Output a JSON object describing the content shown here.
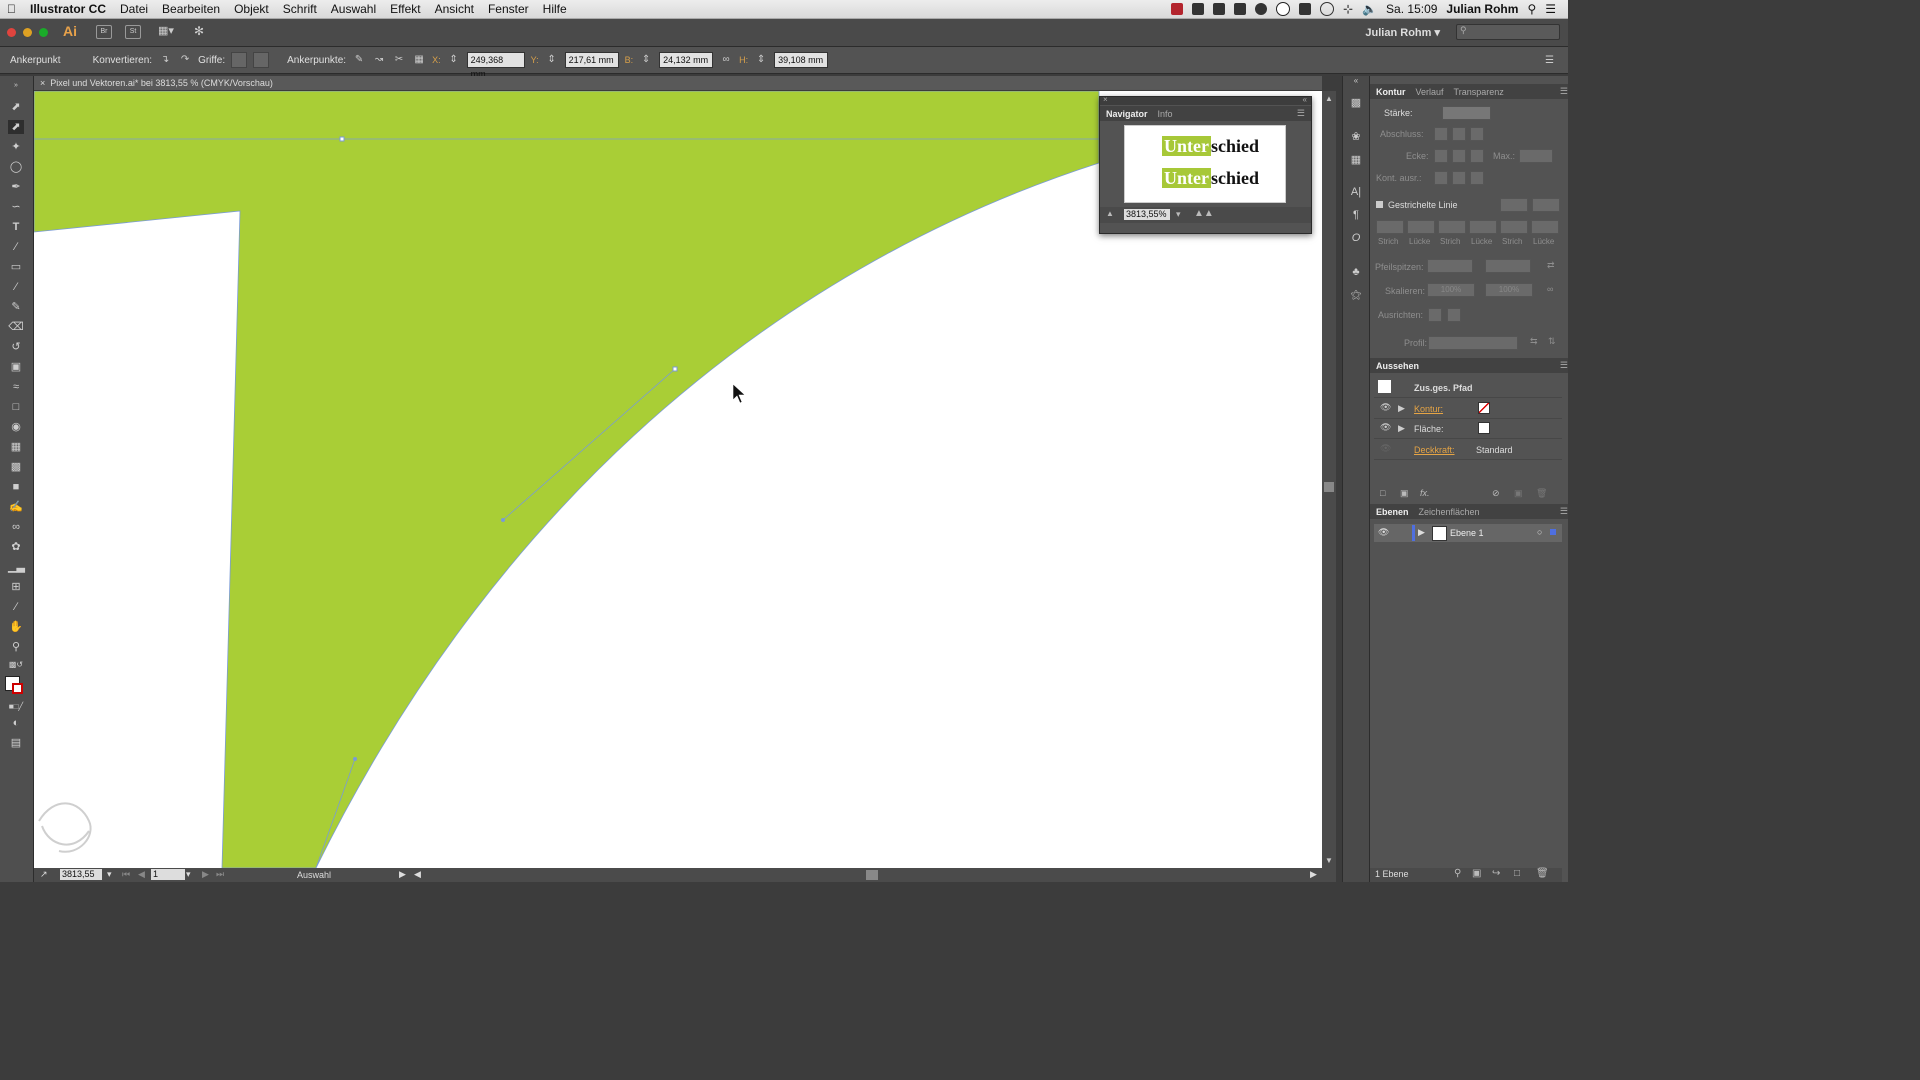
{
  "menubar": {
    "app_name": "Illustrator CC",
    "items": [
      "Datei",
      "Bearbeiten",
      "Objekt",
      "Schrift",
      "Auswahl",
      "Effekt",
      "Ansicht",
      "Fenster",
      "Hilfe"
    ],
    "clock": "Sa. 15:09",
    "user": "Julian Rohm"
  },
  "appbar": {
    "logo": "Ai",
    "bridge": "Br",
    "stock": "St",
    "workspace_user": "Julian Rohm"
  },
  "controlbar": {
    "mode_label": "Ankerpunkt",
    "convert_label": "Konvertieren:",
    "handles_label": "Griffe:",
    "anchors_label": "Ankerpunkte:",
    "x_label": "X:",
    "x_value": "249,368 mm",
    "y_label": "Y:",
    "y_value": "217,61 mm",
    "w_label": "B:",
    "w_value": "24,132 mm",
    "h_label": "H:",
    "h_value": "39,108 mm"
  },
  "document": {
    "tab_title": "Pixel und Vektoren.ai* bei 3813,55 % (CMYK/Vorschau)",
    "fill_color": "#a9ce36"
  },
  "statusbar": {
    "zoom": "3813,55",
    "artboard": "1",
    "tool_status": "Auswahl"
  },
  "navigator": {
    "tab_navigator": "Navigator",
    "tab_info": "Info",
    "word_highlight": "Unter",
    "word_rest": "schied",
    "zoom": "3813,55%"
  },
  "stroke_panel": {
    "tabs": [
      "Kontur",
      "Verlauf",
      "Transparenz"
    ],
    "weight_label": "Stärke:",
    "cap_label": "Abschluss:",
    "corner_label": "Ecke:",
    "limit_label": "Max.:",
    "align_label": "Kont. ausr.:",
    "dashed_label": "Gestrichelte Linie",
    "dash_cols": [
      "Strich",
      "Lücke",
      "Strich",
      "Lücke",
      "Strich",
      "Lücke"
    ],
    "arrow_label": "Pfeilspitzen:",
    "scale_label": "Skalieren:",
    "scale_a": "100%",
    "scale_b": "100%",
    "arrange_label": "Ausrichten:",
    "profile_label": "Profil:"
  },
  "appearance_panel": {
    "title": "Aussehen",
    "object": "Zus.ges. Pfad",
    "stroke": "Kontur:",
    "fill": "Fläche:",
    "opacity": "Deckkraft:",
    "opacity_value": "Standard"
  },
  "layers_panel": {
    "tabs": [
      "Ebenen",
      "Zeichenflächen"
    ],
    "layer": "Ebene 1",
    "count": "1 Ebene"
  }
}
